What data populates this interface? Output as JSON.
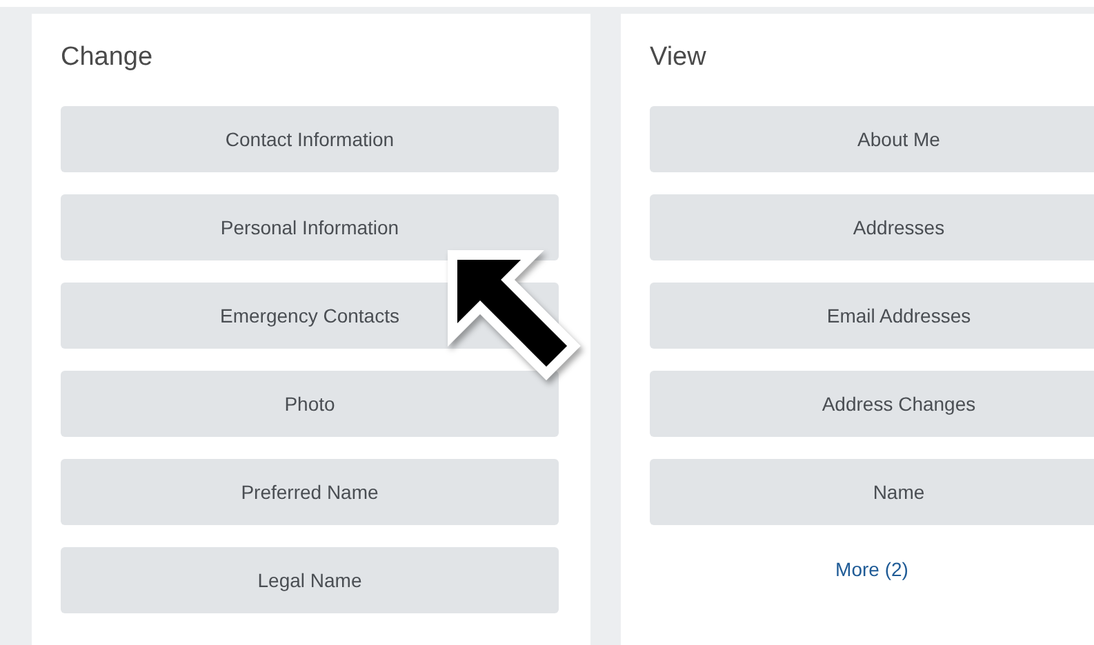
{
  "panels": [
    {
      "title": "Change",
      "buttons": [
        "Contact Information",
        "Personal Information",
        "Emergency Contacts",
        "Photo",
        "Preferred Name",
        "Legal Name"
      ]
    },
    {
      "title": "View",
      "buttons": [
        "About Me",
        "Addresses",
        "Email Addresses",
        "Address Changes",
        "Name"
      ],
      "link": "More (2)"
    }
  ]
}
